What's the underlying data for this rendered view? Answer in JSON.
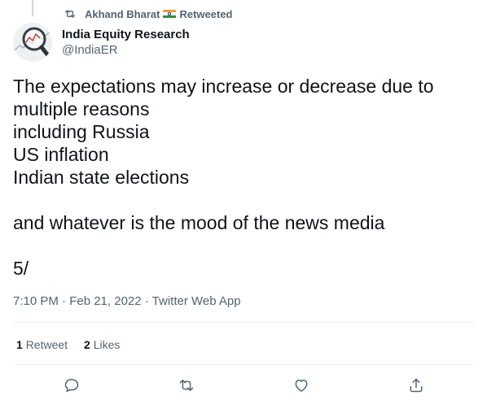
{
  "retweet_banner": {
    "retweeter_name": "Akhand Bharat",
    "label": "Retweeted"
  },
  "author": {
    "name": "India Equity Research",
    "handle": "@IndiaER"
  },
  "tweet": {
    "text": "The expectations may increase or decrease due to multiple reasons\nincluding Russia\nUS inflation\nIndian state elections\n\nand whatever is the mood of the news media\n\n5/"
  },
  "meta": {
    "timestamp": "7:10 PM · Feb 21, 2022 · Twitter Web App"
  },
  "stats": {
    "retweet_count": "1",
    "retweet_label": "Retweet",
    "like_count": "2",
    "like_label": "Likes"
  },
  "icons": {
    "retweet": "retweet-icon",
    "reply": "reply-icon",
    "like": "heart-icon",
    "share": "share-icon",
    "flag": "india-flag-icon"
  },
  "colors": {
    "text_primary": "#0f1419",
    "text_secondary": "#536471",
    "divider": "#eff3f4"
  }
}
